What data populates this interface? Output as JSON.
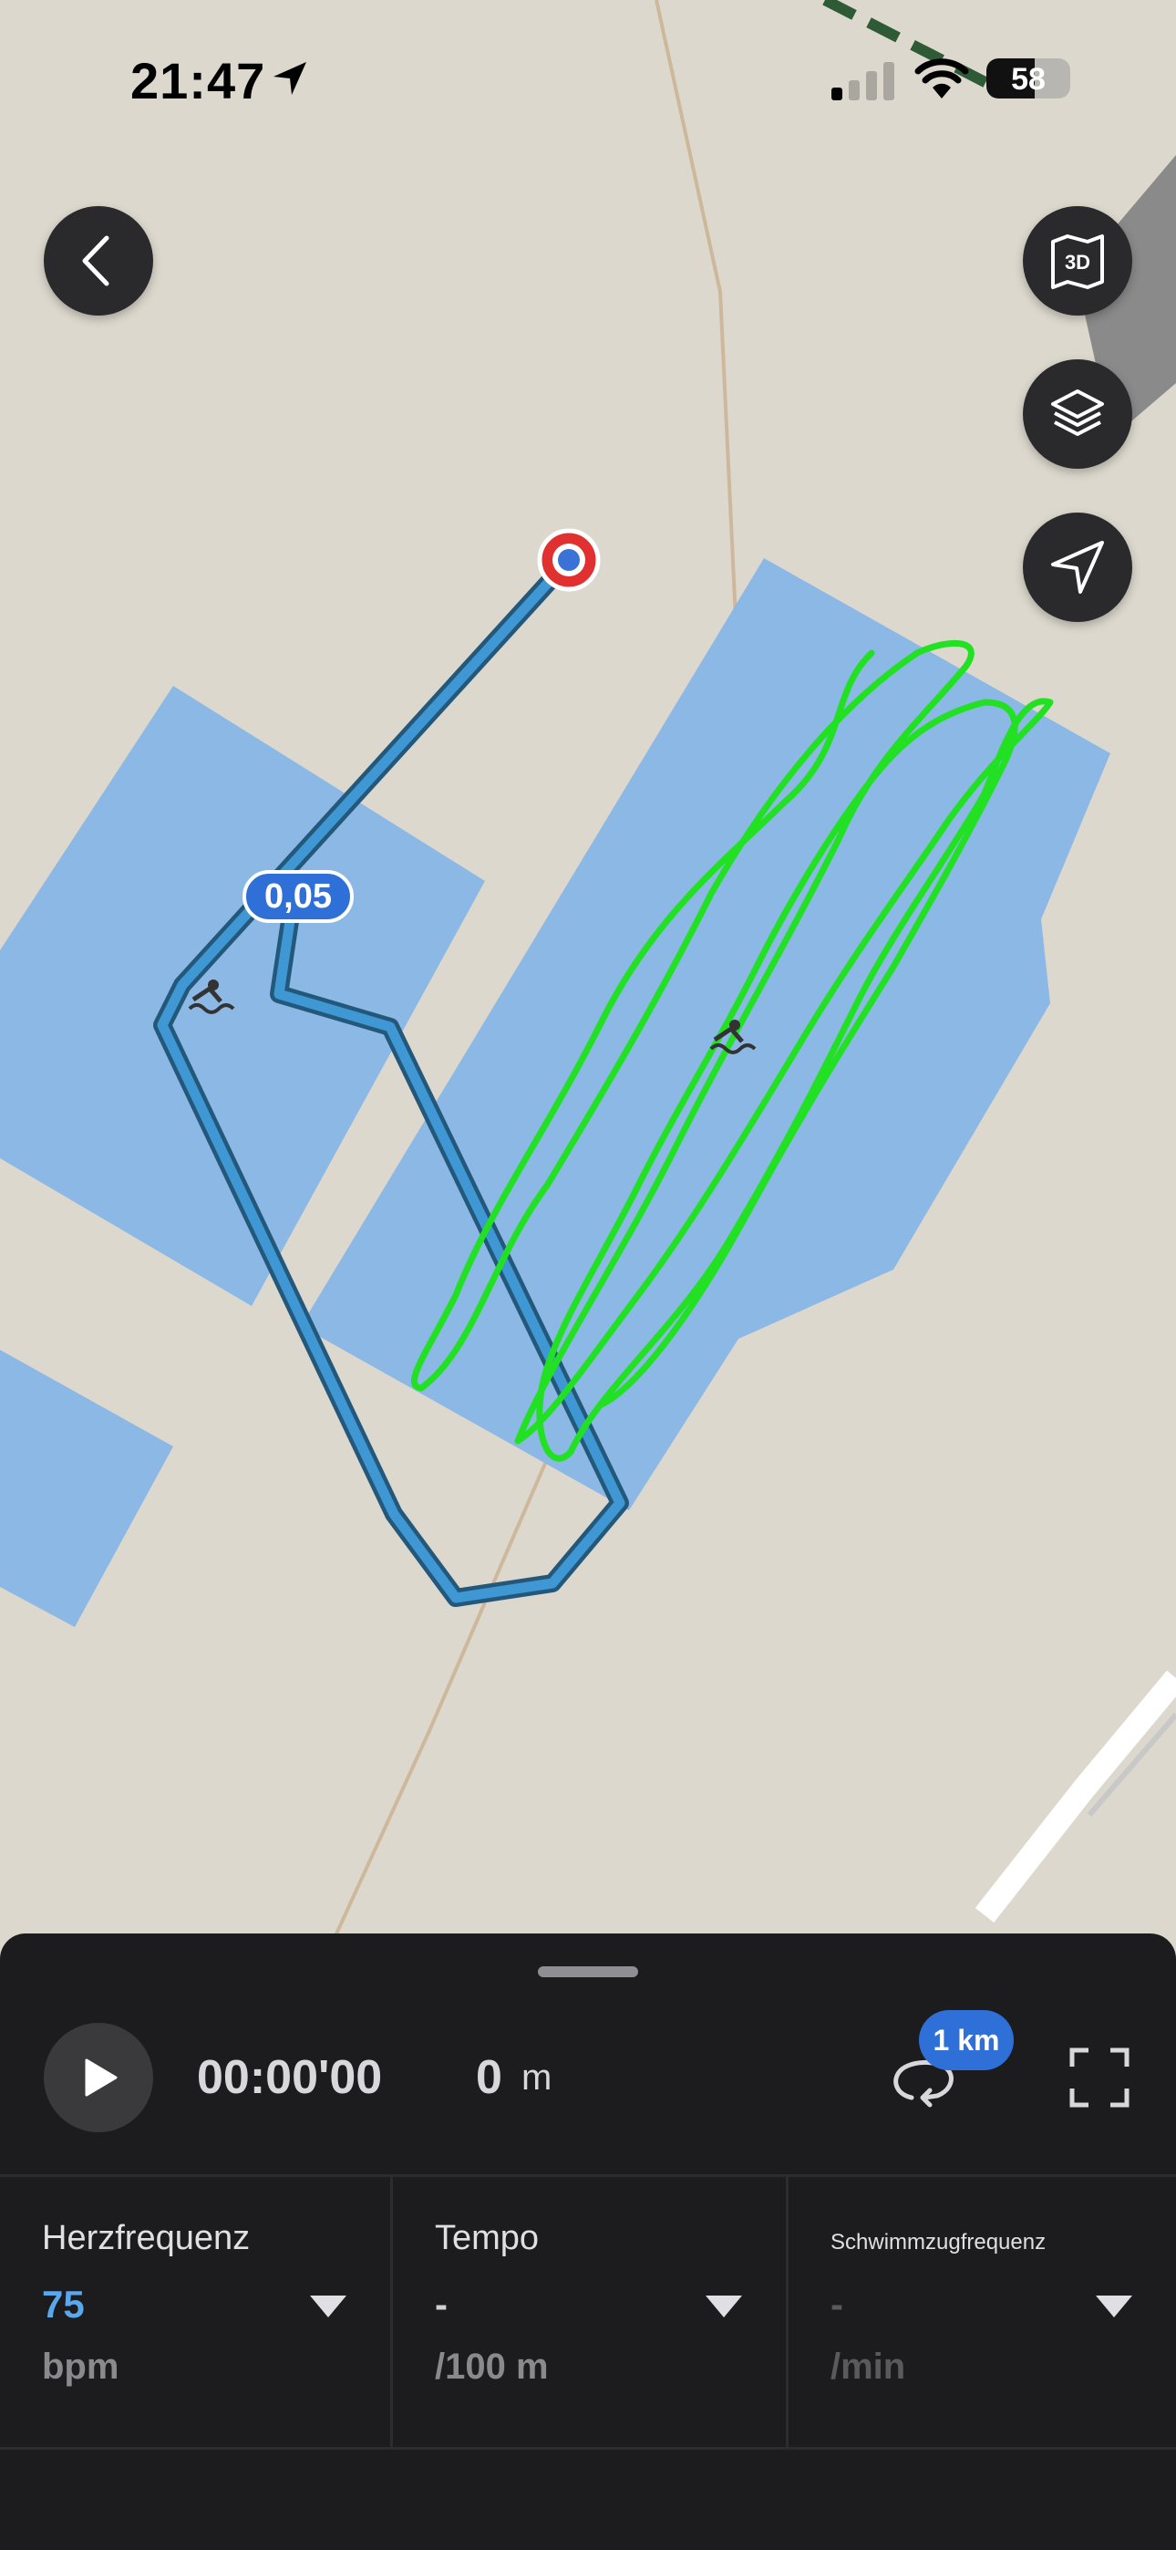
{
  "status_bar": {
    "time": "21:47",
    "battery_level": "58",
    "battery_fraction": 0.58
  },
  "map": {
    "route_marker_label": "0,05"
  },
  "controls": {
    "back_icon": "chevron-left-icon",
    "view_3d_icon": "map-3d-icon",
    "layers_icon": "layers-icon",
    "locate_icon": "navigation-arrow-icon"
  },
  "player": {
    "elapsed_time": "00:00'00",
    "distance_value": "0",
    "distance_unit": "m",
    "lap_badge": "1 km"
  },
  "metrics": [
    {
      "label": "Herzfrequenz",
      "value": "75",
      "unit": "bpm"
    },
    {
      "label": "Tempo",
      "value": "-",
      "unit": "/100 m"
    },
    {
      "label": "Schwimmzugfrequenz",
      "value": "-",
      "unit": "/min"
    }
  ],
  "colors": {
    "route_blue": "#3f97d3",
    "track_green": "#22e022",
    "water": "#8cb8e6",
    "accent_blue": "#2e6fd8",
    "start_marker_red": "#e03030"
  }
}
